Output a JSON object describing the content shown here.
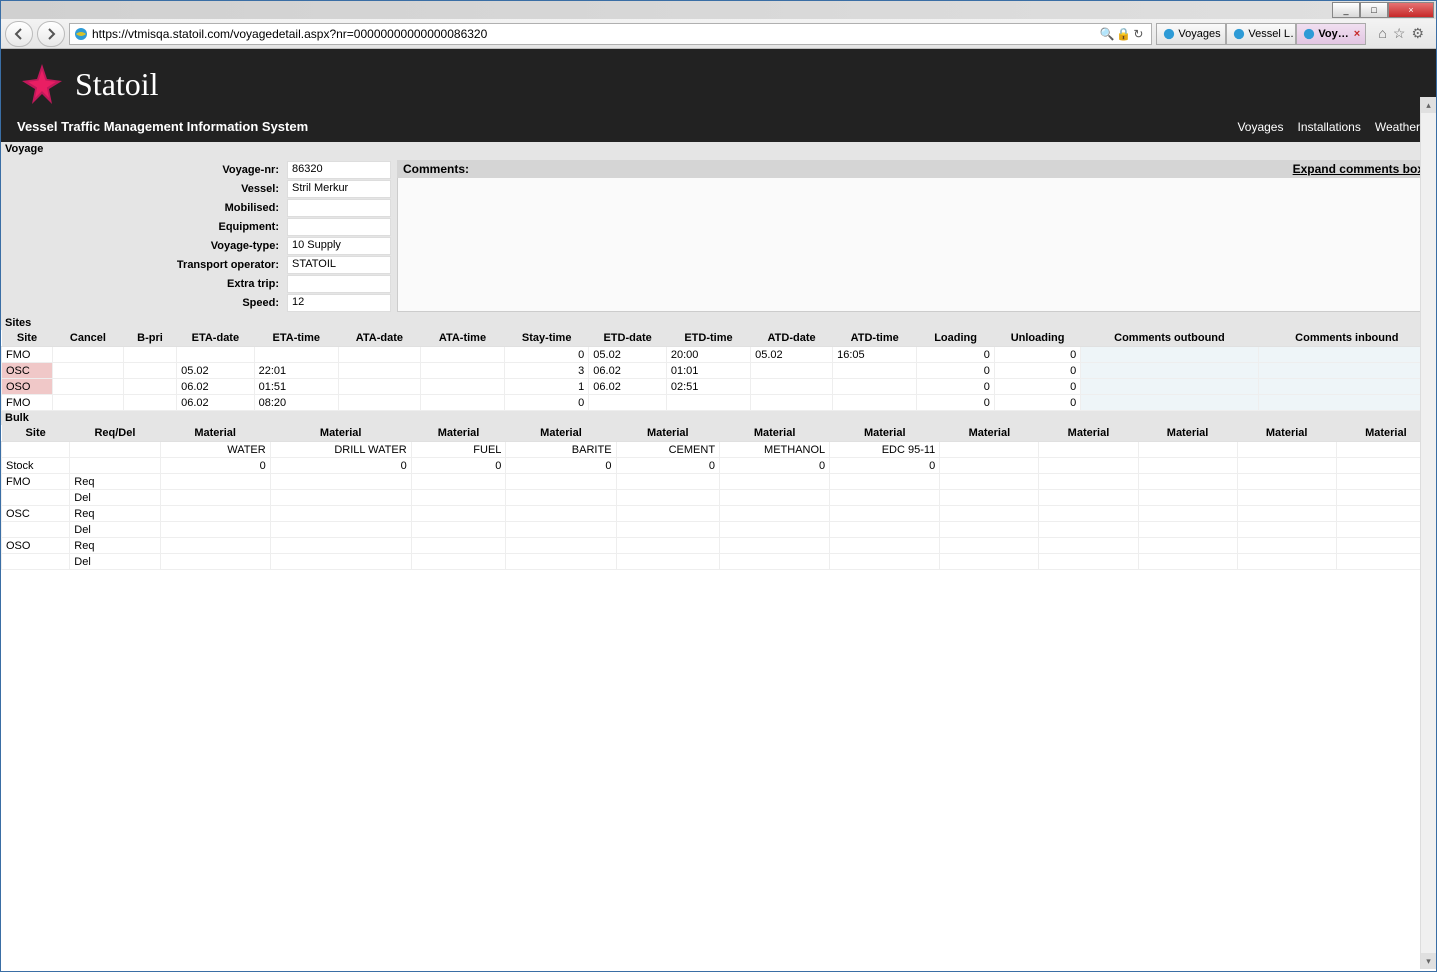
{
  "browser": {
    "url": "https://vtmisqa.statoil.com/voyagedetail.aspx?nr=00000000000000086320",
    "tabs": [
      {
        "label": "Voyages",
        "active": false
      },
      {
        "label": "Vessel L…",
        "active": false
      },
      {
        "label": "Voy…",
        "active": true
      }
    ],
    "window_buttons": {
      "min": "_",
      "max": "□",
      "close": "×"
    }
  },
  "header": {
    "brand": "Statoil",
    "subtitle": "Vessel Traffic Management Information System",
    "nav": {
      "voyages": "Voyages",
      "installations": "Installations",
      "weather": "Weather"
    }
  },
  "voyage": {
    "section_label": "Voyage",
    "fields": {
      "voyage_nr_label": "Voyage-nr:",
      "voyage_nr": "86320",
      "vessel_label": "Vessel:",
      "vessel": "Stril Merkur",
      "mobilised_label": "Mobilised:",
      "mobilised": "",
      "equipment_label": "Equipment:",
      "equipment": "",
      "voyage_type_label": "Voyage-type:",
      "voyage_type": "10 Supply",
      "transport_operator_label": "Transport operator:",
      "transport_operator": "STATOIL",
      "extra_trip_label": "Extra trip:",
      "extra_trip": "",
      "speed_label": "Speed:",
      "speed": "12"
    },
    "comments_label": "Comments:",
    "expand_label": "Expand comments box"
  },
  "sites": {
    "section_label": "Sites",
    "headers": [
      "Site",
      "Cancel",
      "B-pri",
      "ETA-date",
      "ETA-time",
      "ATA-date",
      "ATA-time",
      "Stay-time",
      "ETD-date",
      "ETD-time",
      "ATD-date",
      "ATD-time",
      "Loading",
      "Unloading",
      "Comments outbound",
      "Comments inbound"
    ],
    "rows": [
      {
        "pink": false,
        "cells": [
          "FMO",
          "",
          "",
          "",
          "",
          "",
          "",
          "0",
          "05.02",
          "20:00",
          "05.02",
          "16:05",
          "0",
          "0",
          "",
          ""
        ]
      },
      {
        "pink": true,
        "cells": [
          "OSC",
          "",
          "",
          "05.02",
          "22:01",
          "",
          "",
          "3",
          "06.02",
          "01:01",
          "",
          "",
          "0",
          "0",
          "",
          ""
        ]
      },
      {
        "pink": true,
        "cells": [
          "OSO",
          "",
          "",
          "06.02",
          "01:51",
          "",
          "",
          "1",
          "06.02",
          "02:51",
          "",
          "",
          "0",
          "0",
          "",
          ""
        ]
      },
      {
        "pink": false,
        "cells": [
          "FMO",
          "",
          "",
          "06.02",
          "08:20",
          "",
          "",
          "0",
          "",
          "",
          "",
          "",
          "0",
          "0",
          "",
          ""
        ]
      }
    ]
  },
  "bulk": {
    "section_label": "Bulk",
    "headers": [
      "Site",
      "Req/Del",
      "Material",
      "Material",
      "Material",
      "Material",
      "Material",
      "Material",
      "Material",
      "Material",
      "Material",
      "Material",
      "Material",
      "Material"
    ],
    "material_names": [
      "",
      "",
      "WATER",
      "DRILL WATER",
      "FUEL",
      "BARITE",
      "CEMENT",
      "METHANOL",
      "EDC 95-11",
      "",
      "",
      "",
      "",
      ""
    ],
    "rows": [
      {
        "cells": [
          "Stock",
          "",
          "0",
          "0",
          "0",
          "0",
          "0",
          "0",
          "0",
          "",
          "",
          "",
          "",
          ""
        ]
      },
      {
        "cells": [
          "FMO",
          "Req",
          "",
          "",
          "",
          "",
          "",
          "",
          "",
          "",
          "",
          "",
          "",
          ""
        ]
      },
      {
        "cells": [
          "",
          "Del",
          "",
          "",
          "",
          "",
          "",
          "",
          "",
          "",
          "",
          "",
          "",
          ""
        ]
      },
      {
        "cells": [
          "OSC",
          "Req",
          "",
          "",
          "",
          "",
          "",
          "",
          "",
          "",
          "",
          "",
          "",
          ""
        ]
      },
      {
        "cells": [
          "",
          "Del",
          "",
          "",
          "",
          "",
          "",
          "",
          "",
          "",
          "",
          "",
          "",
          ""
        ]
      },
      {
        "cells": [
          "OSO",
          "Req",
          "",
          "",
          "",
          "",
          "",
          "",
          "",
          "",
          "",
          "",
          "",
          ""
        ]
      },
      {
        "cells": [
          "",
          "Del",
          "",
          "",
          "",
          "",
          "",
          "",
          "",
          "",
          "",
          "",
          "",
          ""
        ]
      }
    ]
  }
}
